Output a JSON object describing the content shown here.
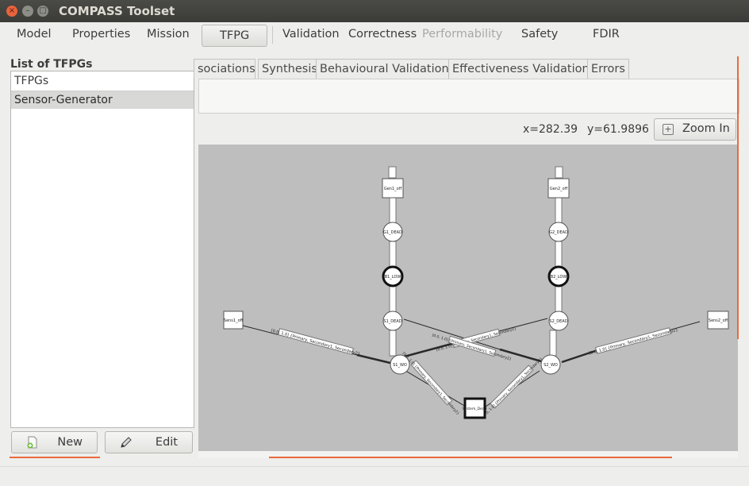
{
  "window": {
    "title": "COMPASS Toolset",
    "close_glyph": "×",
    "minimize_glyph": "–",
    "maximize_glyph": "□"
  },
  "menu": {
    "items": [
      "Model",
      "Properties",
      "Mission",
      "TFPG",
      "Validation",
      "Correctness",
      "Performability",
      "Safety",
      "FDIR"
    ],
    "active": "TFPG",
    "disabled": [
      "Performability"
    ]
  },
  "left_panel": {
    "title": "List of TFPGs",
    "list_header": "TFPGs",
    "items": [
      "Sensor-Generator"
    ],
    "new_button": "New",
    "edit_button": "Edit"
  },
  "tabs": {
    "items": [
      "sociations",
      "Synthesis",
      "Behavioural Validation",
      "Effectiveness Validation",
      "Errors"
    ]
  },
  "toolbar": {
    "x_coord": "x=282.39",
    "y_coord": "y=61.9896",
    "zoom_in_label": "Zoom In",
    "zoom_icon": "zoom-in-icon"
  },
  "graph": {
    "nodes": {
      "gen1_off": "Gen1_off",
      "gen2_off": "Gen2_off",
      "g1_dead": "G1_DEAD",
      "g2_dead": "G2_DEAD",
      "b1_low": "B1_LOW",
      "b2_low": "B2_LOW",
      "s1_dead": "S1_DEAD",
      "s2_dead": "S2_DEAD",
      "sens1_off": "Sens1_off",
      "sens2_off": "Sens2_off",
      "s1_wo": "S1_WO",
      "s2_wo": "S2_WO",
      "system_dead": "System_Dead"
    },
    "edge_label": "[0.0, 1.0] {Primary, Secondary1, Secondary2}",
    "edge_label_short": "[0.0, 1.0] {Primary, Secondary1, Secondary2}"
  },
  "colors": {
    "accent": "#e96b3c",
    "canvas_bg": "#bebebe",
    "titlebar": "#3f3f3c"
  }
}
